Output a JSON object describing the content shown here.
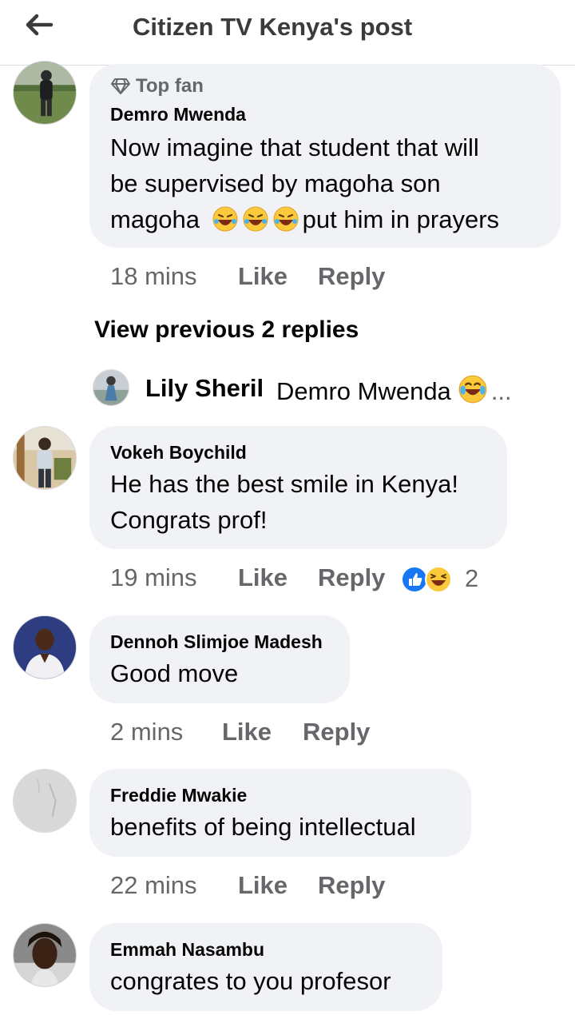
{
  "header": {
    "title": "Citizen TV Kenya's post",
    "back_icon": "arrow-left-icon"
  },
  "comments": [
    {
      "badge": "Top fan",
      "badge_icon": "diamond-icon",
      "name": "Demro Mwenda",
      "line1": "Now imagine that student that will",
      "line2": "be supervised by magoha son",
      "line3_prefix": "magoha",
      "line3_suffix": "put him in prayers",
      "time": "18 mins",
      "like": "Like",
      "reply": "Reply"
    },
    {
      "name": "Vokeh Boychild",
      "line1": "He has the best smile in Kenya!",
      "line2": "Congrats prof!",
      "time": "19 mins",
      "like": "Like",
      "reply": "Reply",
      "reaction_count": "2"
    },
    {
      "name": "Dennoh Slimjoe Madesh",
      "line1": "Good move",
      "time": "2 mins",
      "like": "Like",
      "reply": "Reply"
    },
    {
      "name": "Freddie Mwakie",
      "line1": "benefits of being intellectual",
      "time": "22 mins",
      "like": "Like",
      "reply": "Reply"
    },
    {
      "name": "Emmah Nasambu",
      "line1": "congrates to you profesor"
    }
  ],
  "view_previous": "View previous 2 replies",
  "reply_preview": {
    "name": "Lily Sheril",
    "text": "Demro Mwenda",
    "ellipsis": "..."
  },
  "colors": {
    "bubble": "#f0f2f5",
    "meta": "#65676b",
    "like_blue": "#1877f2",
    "emoji_yellow": "#fcc83c"
  }
}
